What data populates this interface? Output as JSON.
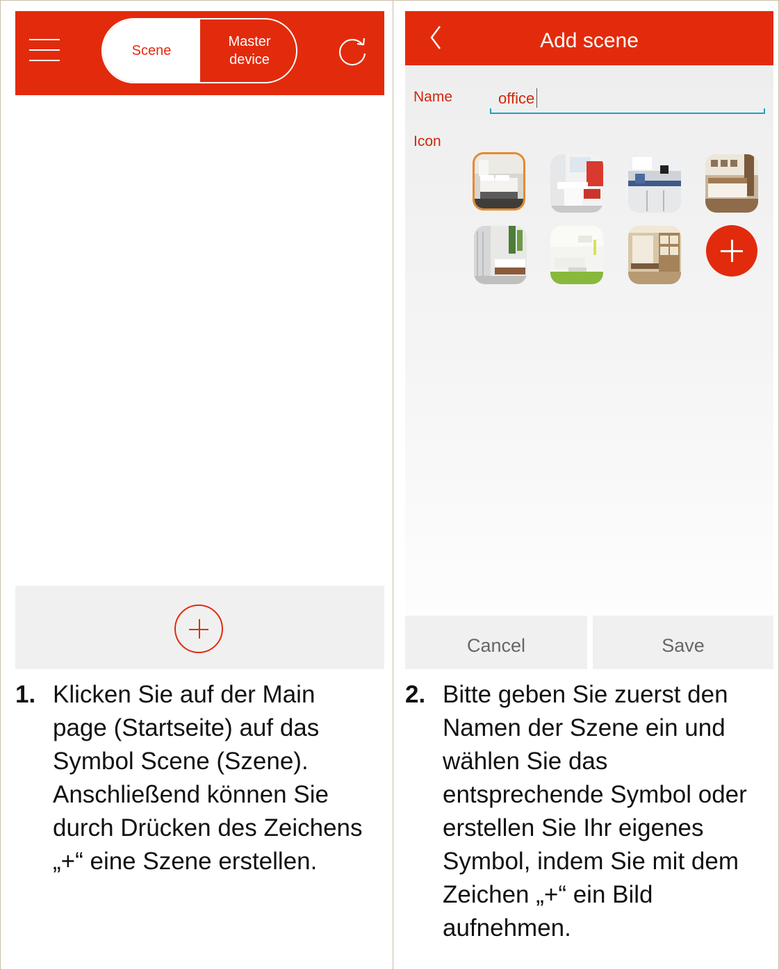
{
  "left_screen": {
    "toggle": {
      "scene_label": "Scene",
      "master_label": "Master\ndevice"
    },
    "icons": {
      "menu": "hamburger-menu-icon",
      "refresh": "refresh-icon",
      "add": "plus-circle-icon"
    }
  },
  "right_screen": {
    "title": "Add scene",
    "name_label": "Name",
    "name_value": "office",
    "icon_label": "Icon",
    "thumbnails": [
      {
        "name": "bedroom",
        "selected": true
      },
      {
        "name": "kitchen-white-red",
        "selected": false
      },
      {
        "name": "kitchen-blue",
        "selected": false
      },
      {
        "name": "bedroom-wood",
        "selected": false
      },
      {
        "name": "bathroom",
        "selected": false
      },
      {
        "name": "living-room",
        "selected": false
      },
      {
        "name": "study",
        "selected": false
      }
    ],
    "cancel_label": "Cancel",
    "save_label": "Save"
  },
  "captions": {
    "step1_num": "1.",
    "step1_lines": [
      "Klicken Sie auf der Main",
      "page (Startseite) auf das",
      "Symbol Scene (Szene).",
      "Anschließend können Sie",
      "durch Drücken des Zeichens",
      "„+“ eine Szene erstellen."
    ],
    "step2_num": "2.",
    "step2_lines": [
      "Bitte geben Sie zuerst den",
      "Namen der Szene ein und",
      "wählen Sie das",
      "entsprechende Symbol oder",
      "erstellen Sie Ihr eigenes",
      "Symbol, indem Sie mit dem",
      "Zeichen „+“ ein Bild",
      "aufnehmen."
    ]
  },
  "colors": {
    "accent": "#e22b0c",
    "input_line": "#1aa3c8",
    "selected_border": "#e68a2c"
  }
}
